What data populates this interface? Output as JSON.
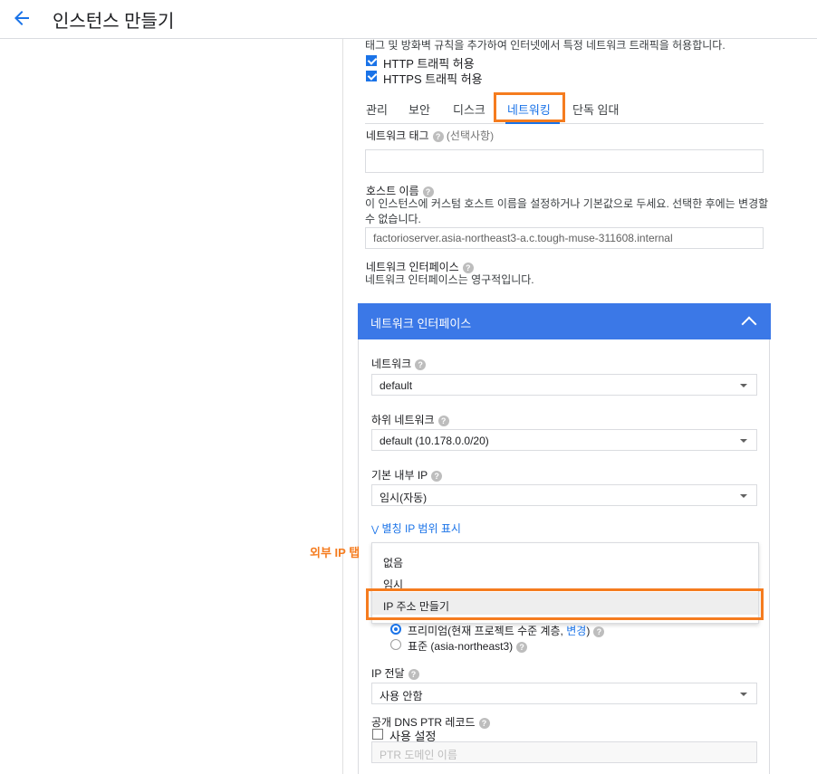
{
  "header": {
    "title": "인스턴스 만들기"
  },
  "firewall": {
    "description": "태그 및 방화벽 규칙을 추가하여 인터넷에서 특정 네트워크 트래픽을 허용합니다.",
    "http": "HTTP 트래픽 허용",
    "https": "HTTPS 트래픽 허용"
  },
  "tabs": [
    "관리",
    "보안",
    "디스크",
    "네트워킹",
    "단독 임대"
  ],
  "network_tags": {
    "label": "네트워크 태그",
    "optional": "(선택사항)"
  },
  "hostname": {
    "label": "호스트 이름",
    "desc_line1": "이 인스턴스에 커스텀 호스트 이름을 설정하거나 기본값으로 두세요. 선택한 후에는 변경할",
    "desc_line2": "수 없습니다.",
    "value": "factorioserver.asia-northeast3-a.c.tough-muse-311608.internal"
  },
  "interfaces": {
    "label": "네트워크 인터페이스",
    "desc": "네트워크 인터페이스는 영구적입니다."
  },
  "panel": {
    "title": "네트워크 인터페이스",
    "network_label": "네트워크",
    "network_value": "default",
    "subnet_label": "하위 네트워크",
    "subnet_value": "default (10.178.0.0/20)",
    "internal_ip_label": "기본 내부 IP",
    "internal_ip_value": "임시(자동)",
    "alias_toggle": "별칭 IP 범위 표시",
    "external_ip_menu": [
      "없음",
      "임시",
      "IP 주소 만들기"
    ],
    "tier_premium": "프리미엄(현재 프로젝트 수준 계층, ",
    "tier_change": "변경",
    "tier_premium_end": ")",
    "tier_standard": "표준 (asia-northeast3)",
    "ip_forward_label": "IP 전달",
    "ip_forward_value": "사용 안함",
    "ptr_label": "공개 DNS PTR 레코드",
    "ptr_enable": "사용 설정",
    "ptr_placeholder": "PTR 도메인 이름"
  },
  "annotation": {
    "external_ip_tab": "외부 IP 탭"
  },
  "colors": {
    "accent": "#1a73e8",
    "panel_header": "#3b78e7",
    "highlight": "#f57c1f"
  }
}
